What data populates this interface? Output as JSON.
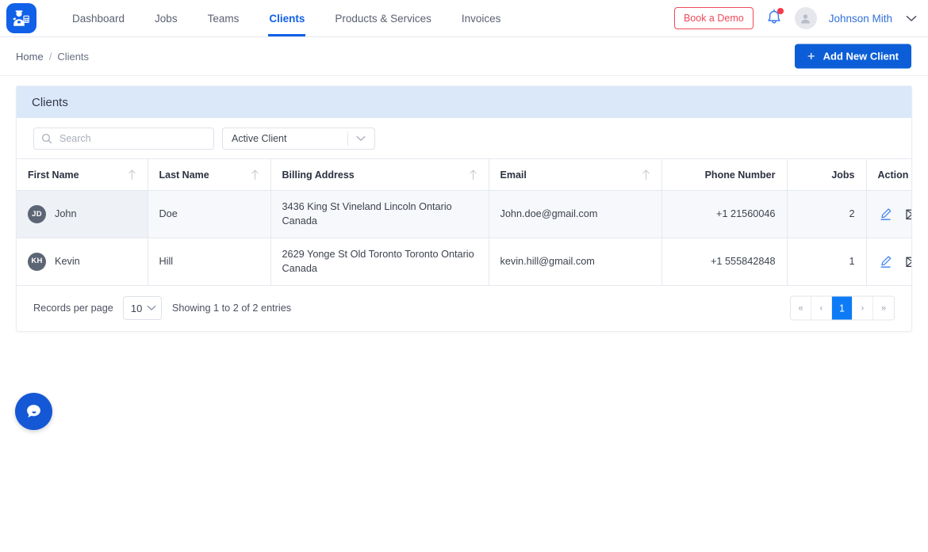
{
  "header": {
    "logo_icon": "worker-logo-icon",
    "nav": [
      {
        "label": "Dashboard",
        "active": false
      },
      {
        "label": "Jobs",
        "active": false
      },
      {
        "label": "Teams",
        "active": false
      },
      {
        "label": "Clients",
        "active": true
      },
      {
        "label": "Products & Services",
        "active": false
      },
      {
        "label": "Invoices",
        "active": false
      }
    ],
    "demo_button": "Book a Demo",
    "notification_icon": "bell-icon",
    "avatar_icon": "user-avatar-icon",
    "user_name": "Johnson Mith",
    "user_chevron_icon": "chevron-down-icon",
    "accent_color": "#1160e8",
    "demo_color": "#ef4a5a"
  },
  "breadcrumb": {
    "home": "Home",
    "separator": "/",
    "current": "Clients"
  },
  "actions": {
    "add_new_client": "Add New Client",
    "add_icon": "plus-icon"
  },
  "card": {
    "title": "Clients",
    "header_bg": "#dbe8f9"
  },
  "filters": {
    "search_placeholder": "Search",
    "search_value": "",
    "search_icon": "search-icon",
    "status_selected": "Active Client",
    "status_chevron_icon": "chevron-down-icon"
  },
  "table": {
    "columns": [
      {
        "label": "First Name",
        "align": "left",
        "sortable": true
      },
      {
        "label": "Last Name",
        "align": "left",
        "sortable": true
      },
      {
        "label": "Billing Address",
        "align": "left",
        "sortable": true
      },
      {
        "label": "Email",
        "align": "left",
        "sortable": true
      },
      {
        "label": "Phone Number",
        "align": "right",
        "sortable": false
      },
      {
        "label": "Jobs",
        "align": "right",
        "sortable": false
      },
      {
        "label": "Action",
        "align": "left",
        "sortable": false
      }
    ],
    "sort_icon": "sort-arrow-up-icon",
    "rows": [
      {
        "initials": "JD",
        "first_name": "John",
        "last_name": "Doe",
        "billing_address": "3436 King St Vineland Lincoln Ontario Canada",
        "email": "John.doe@gmail.com",
        "phone": "+1 21560046",
        "jobs": "2",
        "edit_icon": "pencil-edit-icon",
        "mail_icon": "envelope-icon",
        "highlighted": true
      },
      {
        "initials": "KH",
        "first_name": "Kevin",
        "last_name": "Hill",
        "billing_address": "2629 Yonge St Old Toronto Toronto Ontario Canada",
        "email": "kevin.hill@gmail.com",
        "phone": "+1 555842848",
        "jobs": "1",
        "edit_icon": "pencil-edit-icon",
        "mail_icon": "envelope-icon",
        "highlighted": false
      }
    ]
  },
  "footer": {
    "records_label": "Records per page",
    "records_value": "10",
    "records_chevron_icon": "chevron-down-icon",
    "showing": "Showing 1 to 2 of 2 entries",
    "pagination": [
      {
        "label": "«",
        "name": "first",
        "active": false
      },
      {
        "label": "‹",
        "name": "prev",
        "active": false
      },
      {
        "label": "1",
        "name": "page-1",
        "active": true
      },
      {
        "label": "›",
        "name": "next",
        "active": false
      },
      {
        "label": "»",
        "name": "last",
        "active": false
      }
    ],
    "active_color": "#0d7bf5"
  },
  "chat": {
    "icon": "chat-bubble-icon",
    "color": "#1558d6"
  }
}
